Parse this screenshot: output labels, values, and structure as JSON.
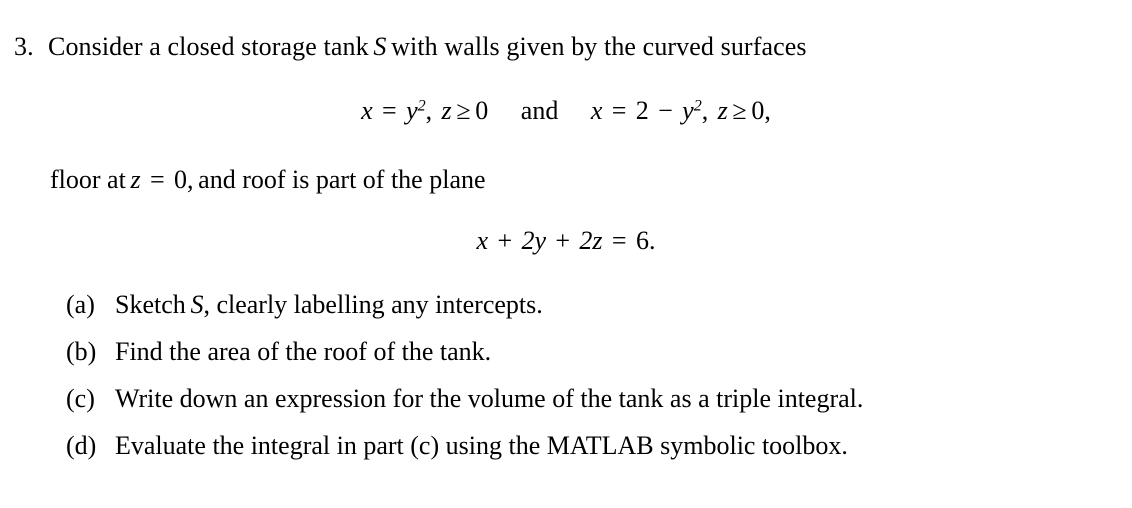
{
  "document": {
    "type": "math-exercise",
    "background_color": "#ffffff",
    "text_color": "#000000"
  },
  "question": {
    "number": "3.",
    "intro": {
      "before_symbol": "Consider a closed storage tank",
      "symbol": "S",
      "after_symbol": "with walls given by the curved surfaces"
    },
    "equation_1": {
      "plain": "x = y², z ≥ 0   and   x = 2 − y², z ≥ 0,",
      "left": {
        "lhs": "x",
        "eq": "=",
        "rhs_base": "y",
        "rhs_exp": "2",
        "comma": ",",
        "cond_var": "z",
        "cond_rel": "≥",
        "cond_val": "0"
      },
      "conjunction": "and",
      "right": {
        "lhs": "x",
        "eq": "=",
        "rhs_num": "2",
        "minus": "−",
        "rhs_base": "y",
        "rhs_exp": "2",
        "comma": ",",
        "cond_var": "z",
        "cond_rel": "≥",
        "cond_val": "0,",
        "trailing": ","
      }
    },
    "floor_line": {
      "before": "floor at",
      "var": "z",
      "eq": "=",
      "val": "0,",
      "after": "and roof is part of the plane"
    },
    "equation_2": {
      "plain": "x + 2y + 2z = 6.",
      "terms": [
        "x",
        "+",
        "2y",
        "+",
        "2z",
        "=",
        "6."
      ]
    },
    "parts": [
      {
        "label": "(a)",
        "text_before_symbol": "Sketch",
        "symbol": "S",
        "text_after_symbol": ", clearly labelling any intercepts.",
        "plain": "Sketch S, clearly labelling any intercepts."
      },
      {
        "label": "(b)",
        "text_before_symbol": "Find the area of the roof of the tank.",
        "symbol": "",
        "text_after_symbol": "",
        "plain": "Find the area of the roof of the tank."
      },
      {
        "label": "(c)",
        "text_before_symbol": "Write down an expression for the volume of the tank as a triple integral.",
        "symbol": "",
        "text_after_symbol": "",
        "plain": "Write down an expression for the volume of the tank as a triple integral."
      },
      {
        "label": "(d)",
        "text_before_symbol": "Evaluate the integral in part (c) using the MATLAB symbolic toolbox.",
        "symbol": "",
        "text_after_symbol": "",
        "plain": "Evaluate the integral in part (c) using the MATLAB symbolic toolbox."
      }
    ]
  }
}
